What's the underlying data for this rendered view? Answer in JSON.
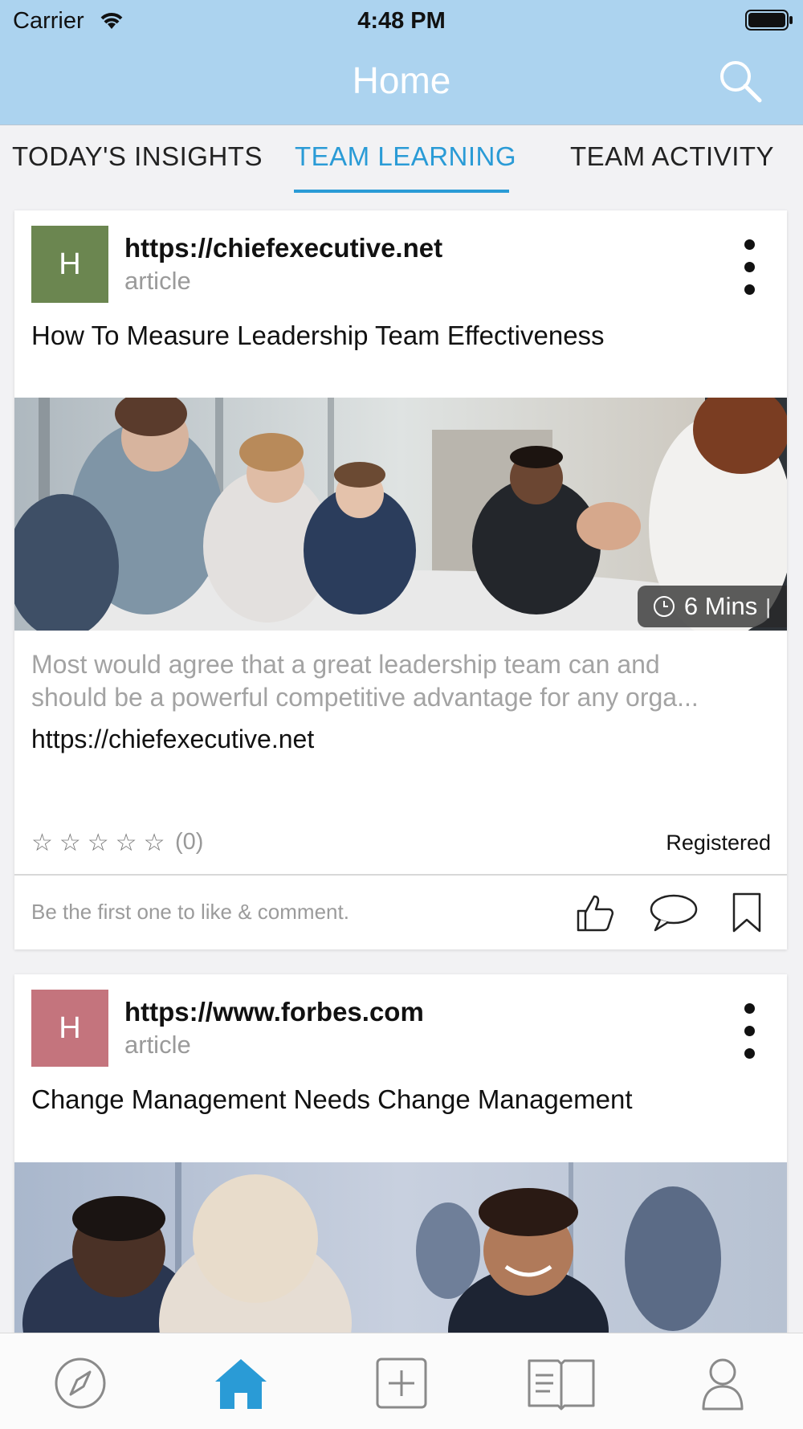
{
  "status_bar": {
    "carrier": "Carrier",
    "time": "4:48 PM"
  },
  "header": {
    "title": "Home",
    "search_icon": "search-icon"
  },
  "tabs": [
    {
      "label": "TODAY'S INSIGHTS",
      "active": false
    },
    {
      "label": "TEAM LEARNING",
      "active": true
    },
    {
      "label": "TEAM ACTIVITY",
      "active": false
    }
  ],
  "feed": [
    {
      "avatar_letter": "H",
      "avatar_color": "#6b8650",
      "source": "https://chiefexecutive.net",
      "type": "article",
      "title": "How To Measure Leadership Team Effectiveness",
      "duration": "6 Mins",
      "description_line1": "Most would agree that a great leadership team can and",
      "description_line2": "should be a powerful competitive advantage for any orga...",
      "link": "https://chiefexecutive.net",
      "rating": 0,
      "rating_count": "(0)",
      "status": "Registered",
      "engagement_prompt": "Be the first one to like & comment."
    },
    {
      "avatar_letter": "H",
      "avatar_color": "#c4747d",
      "source": "https://www.forbes.com",
      "type": "article",
      "title": "Change Management Needs Change Management"
    }
  ],
  "tab_bar": {
    "items": [
      {
        "icon": "compass-icon",
        "active": false
      },
      {
        "icon": "home-icon",
        "active": true
      },
      {
        "icon": "add-icon",
        "active": false
      },
      {
        "icon": "book-icon",
        "active": false
      },
      {
        "icon": "profile-icon",
        "active": false
      }
    ],
    "active_color": "#2a9bd6"
  }
}
